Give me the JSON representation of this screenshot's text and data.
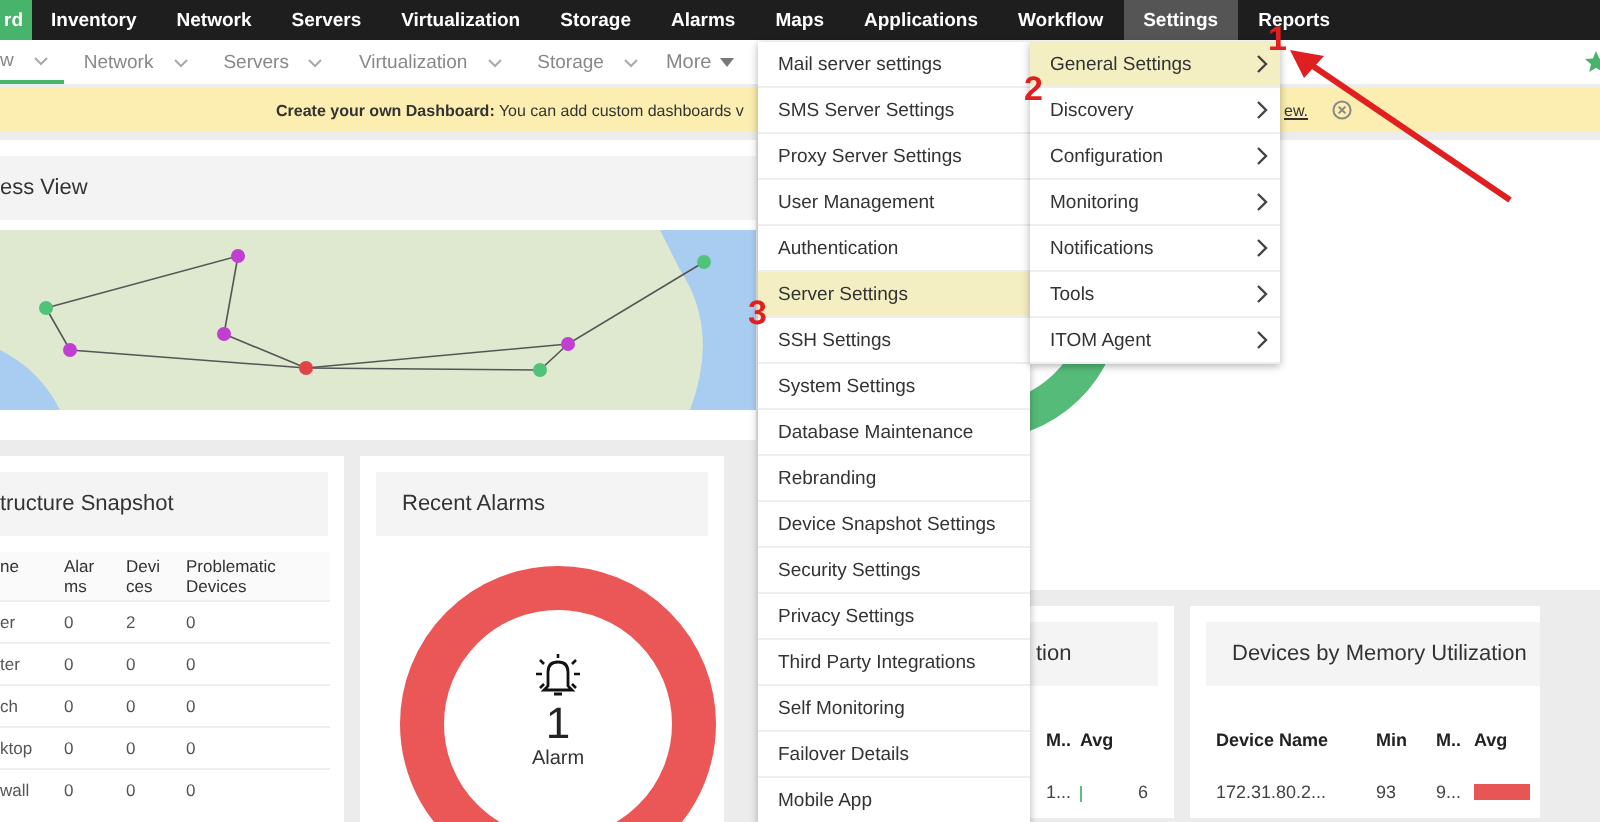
{
  "top_nav": [
    {
      "label": "rd",
      "selected": true,
      "open": false
    },
    {
      "label": "Inventory",
      "selected": false,
      "open": false
    },
    {
      "label": "Network",
      "selected": false,
      "open": false
    },
    {
      "label": "Servers",
      "selected": false,
      "open": false
    },
    {
      "label": "Virtualization",
      "selected": false,
      "open": false
    },
    {
      "label": "Storage",
      "selected": false,
      "open": false
    },
    {
      "label": "Alarms",
      "selected": false,
      "open": false
    },
    {
      "label": "Maps",
      "selected": false,
      "open": false
    },
    {
      "label": "Applications",
      "selected": false,
      "open": false
    },
    {
      "label": "Workflow",
      "selected": false,
      "open": false
    },
    {
      "label": "Settings",
      "selected": false,
      "open": true
    },
    {
      "label": "Reports",
      "selected": false,
      "open": false
    }
  ],
  "sub_nav": {
    "items": [
      {
        "label": "w",
        "selected": true
      },
      {
        "label": "Network",
        "selected": false
      },
      {
        "label": "Servers",
        "selected": false
      },
      {
        "label": "Virtualization",
        "selected": false
      },
      {
        "label": "Storage",
        "selected": false
      }
    ],
    "more": "More"
  },
  "banner": {
    "text": "**Create your own Dashboard:** You can add custom dashboards v",
    "link": "ew."
  },
  "business_view": {
    "title": "ess View"
  },
  "snapshot": {
    "title": "tructure Snapshot",
    "columns": [
      "ne",
      "Alarms",
      "Devices",
      "Problematic Devices"
    ],
    "rows": [
      [
        "er",
        "0",
        "2",
        "0"
      ],
      [
        "ter",
        "0",
        "0",
        "0"
      ],
      [
        "ch",
        "0",
        "0",
        "0"
      ],
      [
        "ktop",
        "0",
        "0",
        "0"
      ],
      [
        "wall",
        "0",
        "0",
        "0"
      ]
    ]
  },
  "recent_alarms": {
    "title": "Recent Alarms",
    "count": "1",
    "label": "Alarm"
  },
  "cpu_card": {
    "title": "tion",
    "columns": [
      "M..",
      "Avg"
    ],
    "rows": [
      {
        "max": "1...",
        "avg": "6",
        "level": 0.05,
        "color": "#5cbf7d"
      }
    ]
  },
  "memory_card": {
    "title": "Devices by Memory Utilization",
    "columns": [
      "Device Name",
      "Min",
      "M..",
      "Avg"
    ],
    "rows": [
      {
        "device": "172.31.80.2...",
        "min": "93",
        "max": "9...",
        "level": 1,
        "color": "#e85555"
      }
    ]
  },
  "settings_menu": {
    "items": [
      {
        "label": "Mail server settings",
        "selected": false
      },
      {
        "label": "SMS Server Settings",
        "selected": false
      },
      {
        "label": "Proxy Server Settings",
        "selected": false
      },
      {
        "label": "User Management",
        "selected": false
      },
      {
        "label": "Authentication",
        "selected": false
      },
      {
        "label": "Server Settings",
        "selected": true
      },
      {
        "label": "SSH Settings",
        "selected": false
      },
      {
        "label": "System Settings",
        "selected": false
      },
      {
        "label": "Database Maintenance",
        "selected": false
      },
      {
        "label": "Rebranding",
        "selected": false
      },
      {
        "label": "Device Snapshot Settings",
        "selected": false
      },
      {
        "label": "Security Settings",
        "selected": false
      },
      {
        "label": "Privacy Settings",
        "selected": false
      },
      {
        "label": "Third Party Integrations",
        "selected": false
      },
      {
        "label": "Self Monitoring",
        "selected": false
      },
      {
        "label": "Failover Details",
        "selected": false
      },
      {
        "label": "Mobile App",
        "selected": false
      }
    ]
  },
  "general_menu": {
    "items": [
      {
        "label": "General Settings",
        "selected": true
      },
      {
        "label": "Discovery",
        "selected": false
      },
      {
        "label": "Configuration",
        "selected": false
      },
      {
        "label": "Monitoring",
        "selected": false
      },
      {
        "label": "Notifications",
        "selected": false
      },
      {
        "label": "Tools",
        "selected": false
      },
      {
        "label": "ITOM Agent",
        "selected": false
      }
    ]
  },
  "annotations": [
    "1",
    "2",
    "3"
  ]
}
